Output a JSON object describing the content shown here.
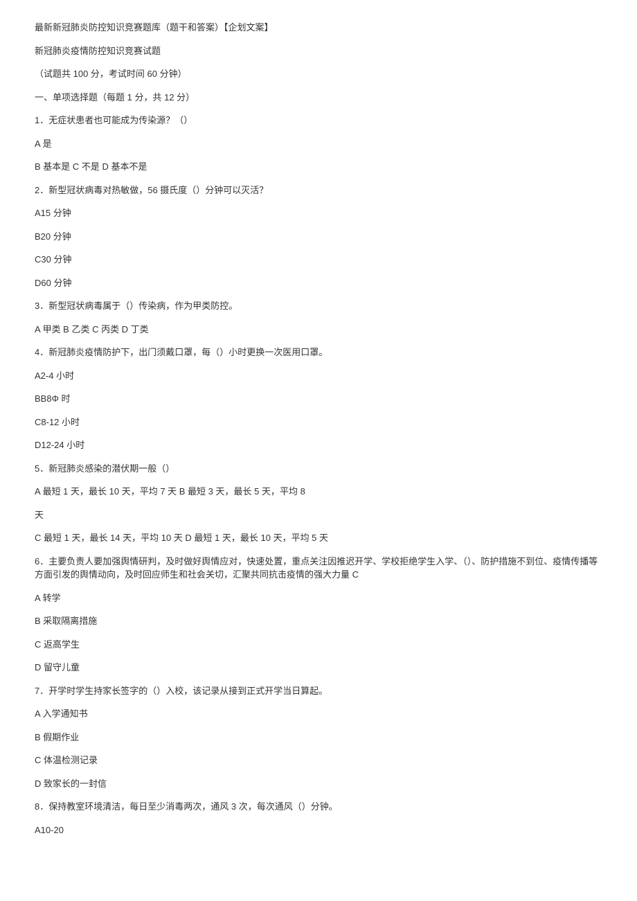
{
  "title": "最新新冠肺炎防控知识竞赛题库（题干和答案）【企划文案】",
  "subtitle": "新冠肺炎疫情防控知识竞赛试题",
  "exam_info": "（试题共 100 分，考试时间 60 分钟）",
  "section_header": "一、单项选择题（每题 1 分，共 12 分）",
  "q1": {
    "num": "1",
    "text": "．无症状患者也可能成为传染源？（）",
    "a": "A 是",
    "b": "B 基本是 C 不是 D 基本不是"
  },
  "q2": {
    "num": "2",
    "text": "．新型冠状病毒对热敏做，56 摄氏度（）分钟可以灭活？",
    "a": "A15 分钟",
    "b": "B20 分钟",
    "c": "C30 分钟",
    "d": "D60 分钟"
  },
  "q3": {
    "num": "3",
    "text": "．新型冠状病毒属于（）传染病，作为甲类防控。",
    "opts": "A 甲类 B 乙类 C 丙类 D 丁类"
  },
  "q4": {
    "num": "4",
    "text": "．新冠肺炎疫情防护下，出门须戴口罩，每（）小时更换一次医用口罩。",
    "a": "A2-4 小时",
    "b": "BB8Φ 时",
    "c": "C8-12 小时",
    "d": "D12-24 小时"
  },
  "q5": {
    "num": "5",
    "text": "．新冠肺炎感染的潜伏期一般（）",
    "line1": "A 最短 1 天，最长 10 天，平均 7 天 B 最短 3 天，最长 5 天，平均 8",
    "line2": "天",
    "line3": "C 最短 1 天，最长 14 天，平均 10 天 D 最短 1 天，最长 10 天，平均 5 天"
  },
  "q6": {
    "num": "6",
    "text": "．主要负责人要加强舆情研判，及时做好舆情应对，快速处置，重点关注因推迟开学、学校拒绝学生入学、（）、防护措施不到位、疫情传播等方面引发的舆情动向，及时回应师生和社会关切，汇聚共同抗击疫情的强大力量 C",
    "a": "A 转学",
    "b": "B 采取隔离措施",
    "c": "C 返高学生",
    "d": "D 留守儿童"
  },
  "q7": {
    "num": "7",
    "text": "．开学时学生持家长签字的（）入校，该记录从接到正式开学当日算起。",
    "a": "A 入学通知书",
    "b": "B 假期作业",
    "c": "C 体温检测记录",
    "d": "D 致家长的一封信"
  },
  "q8": {
    "num": "8",
    "text": "．保持教室环境清洁，每日至少消毒两次，通风 3 次，每次通风（）分钟。",
    "a": "A10-20"
  }
}
